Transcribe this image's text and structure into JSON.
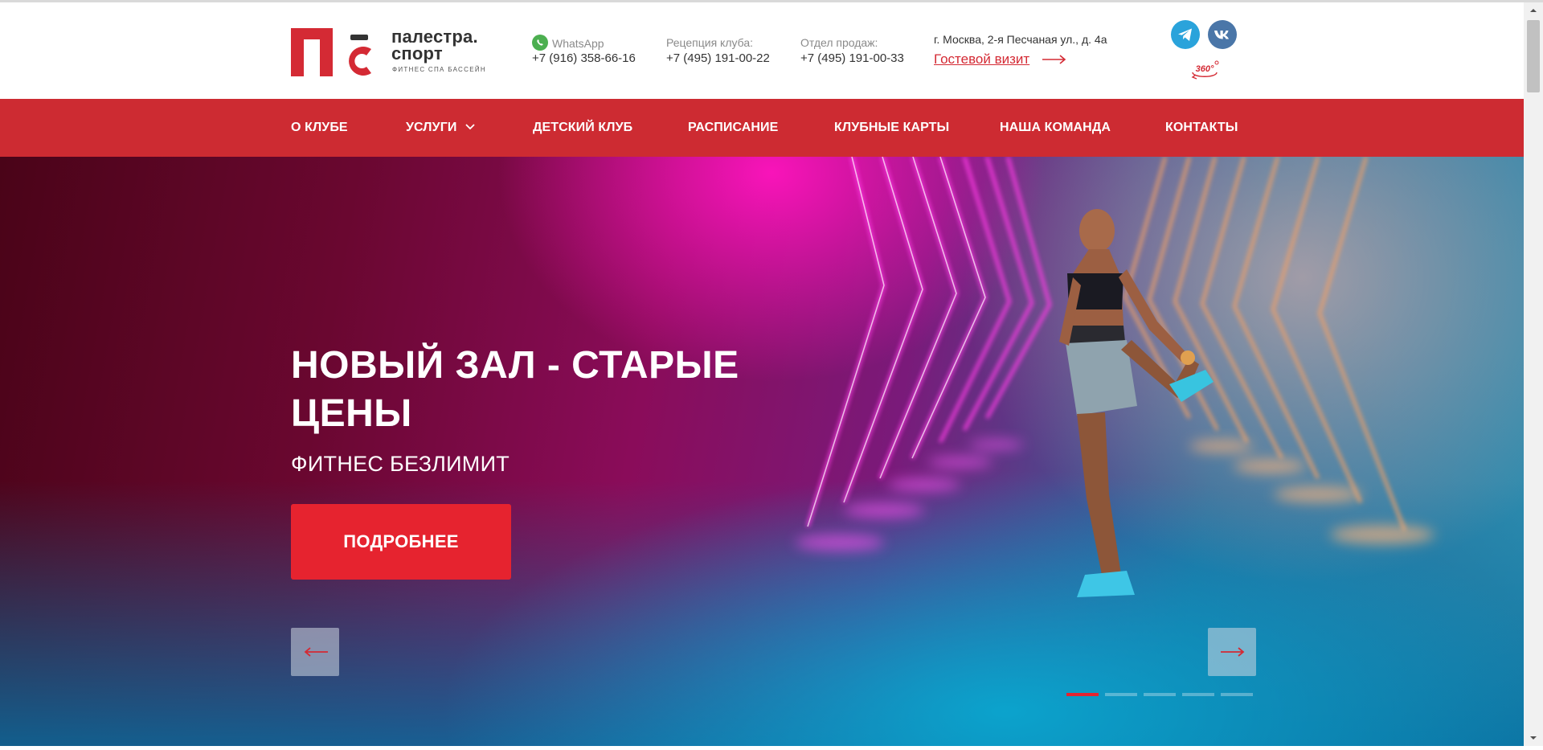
{
  "brand": {
    "name_line1": "палестра.",
    "name_line2": "спорт",
    "tagline": "ФИТНЕС  СПА  БАССЕЙН",
    "logo_color": "#d42a34"
  },
  "contacts": {
    "whatsapp": {
      "label": "WhatsApp",
      "phone": "+7 (916) 358-66-16"
    },
    "reception": {
      "label": "Рецепция клуба:",
      "phone": "+7 (495) 191-00-22"
    },
    "sales": {
      "label": "Отдел продаж:",
      "phone": "+7 (495) 191-00-33"
    },
    "address": "г. Москва, 2-я Песчаная ул., д. 4а",
    "guest_visit": "Гостевой визит"
  },
  "social": {
    "telegram_icon": "telegram-icon",
    "vk_icon": "vk-icon",
    "tour_label": "360°"
  },
  "nav": {
    "items": [
      {
        "label": "О КЛУБЕ"
      },
      {
        "label": "УСЛУГИ",
        "has_dropdown": true
      },
      {
        "label": "ДЕТСКИЙ КЛУБ"
      },
      {
        "label": "РАСПИСАНИЕ"
      },
      {
        "label": "КЛУБНЫЕ КАРТЫ"
      },
      {
        "label": "НАША КОМАНДА"
      },
      {
        "label": "КОНТАКТЫ"
      }
    ]
  },
  "hero": {
    "title": "НОВЫЙ ЗАЛ - СТАРЫЕ ЦЕНЫ",
    "subtitle": "ФИТНЕС БЕЗЛИМИТ",
    "button": "ПОДРОБНЕЕ",
    "slides_total": 5,
    "active_slide": 1
  },
  "colors": {
    "accent": "#e6232f",
    "nav_bg": "#cd2b32",
    "text": "#333333"
  }
}
